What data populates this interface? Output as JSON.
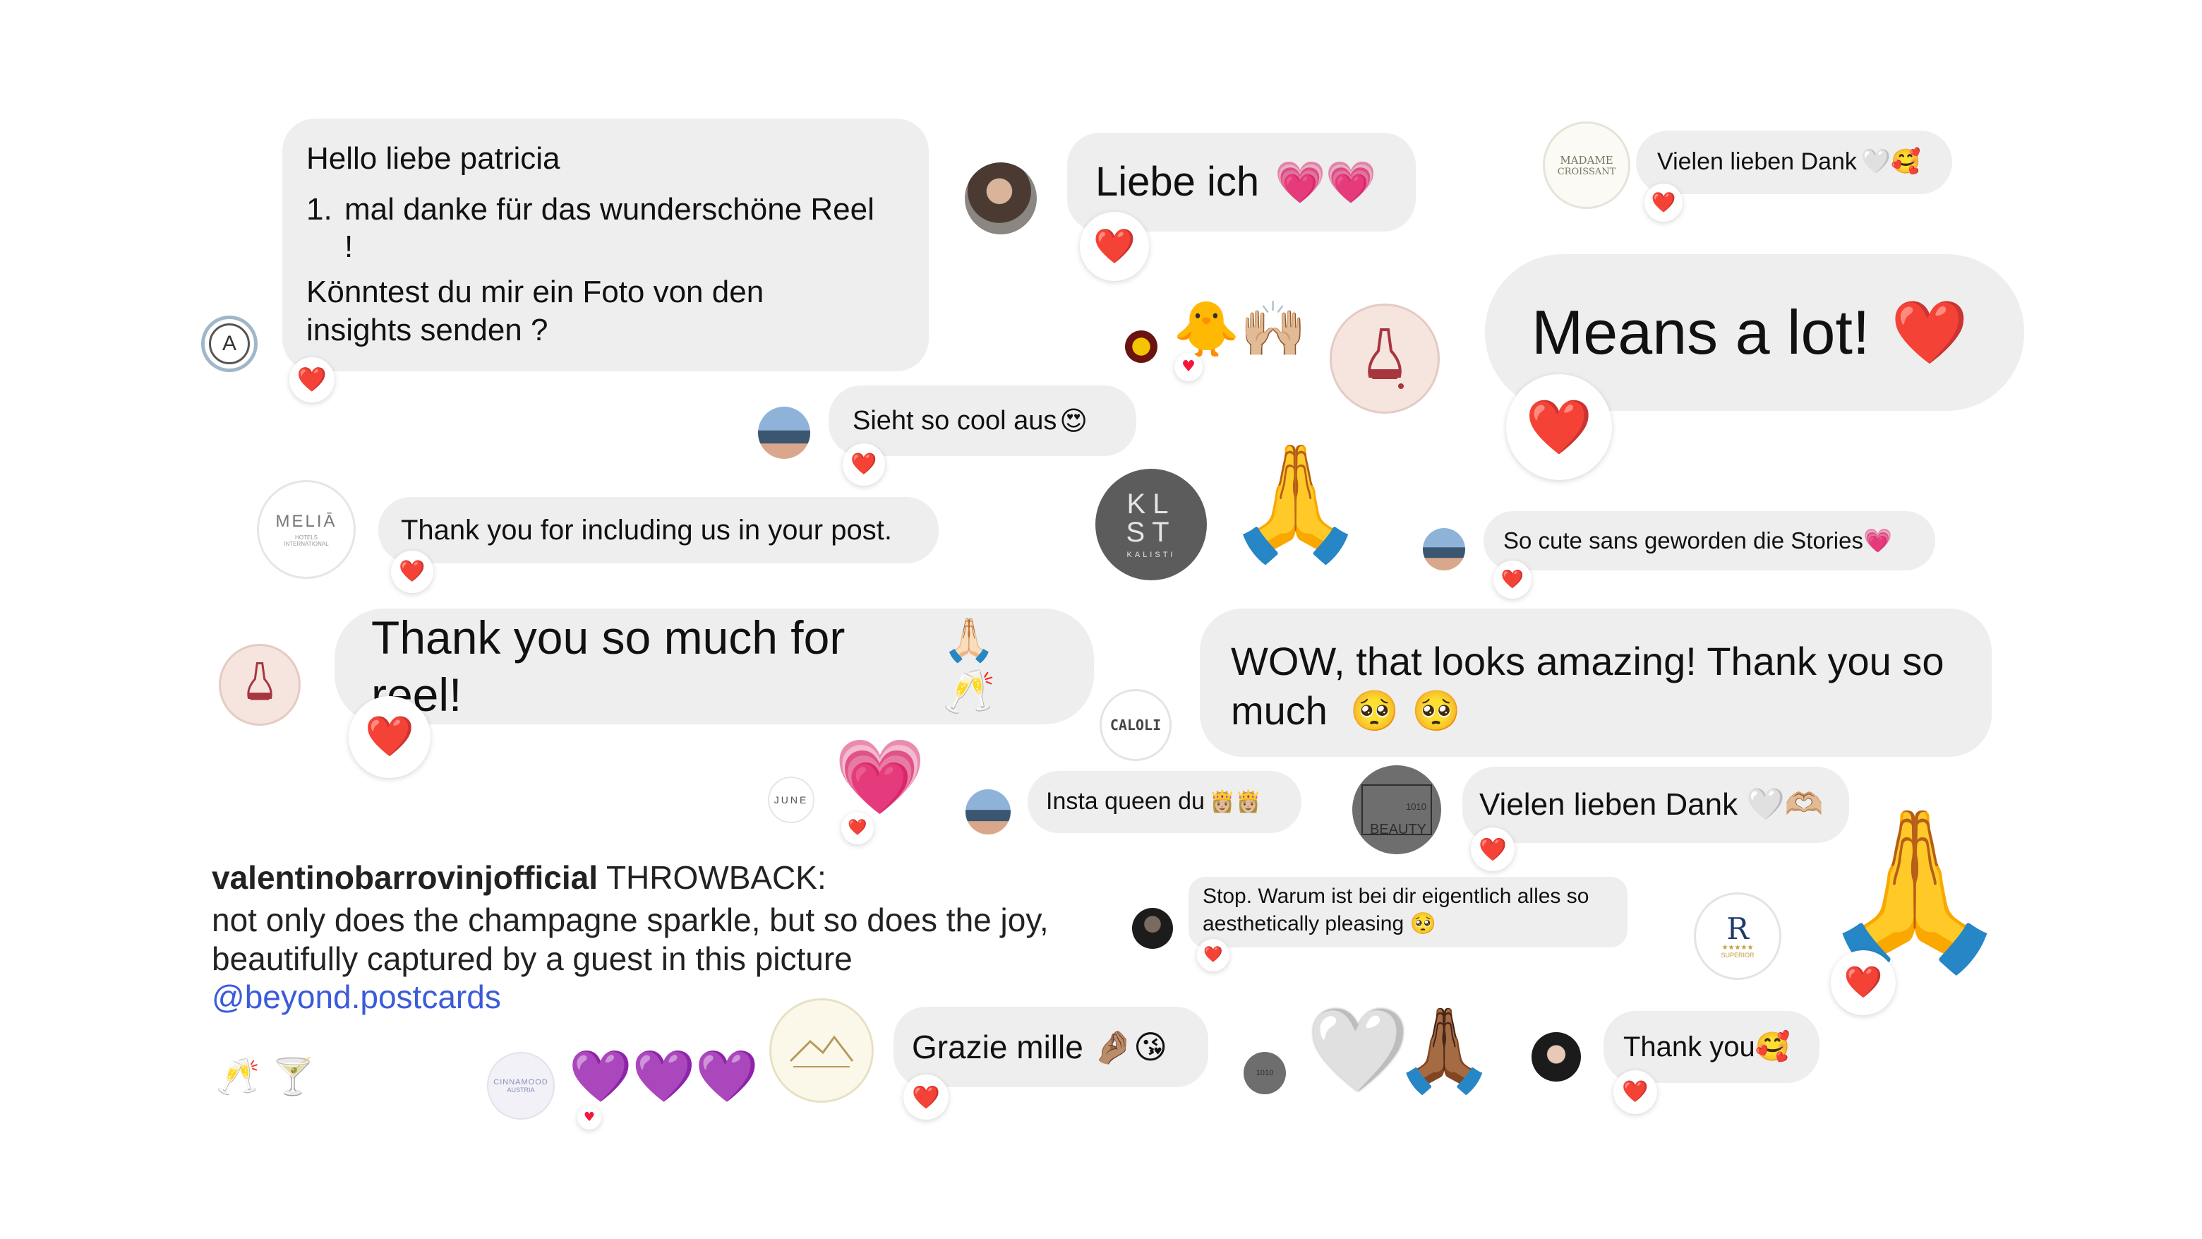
{
  "colors": {
    "bubble": "#eeeeef",
    "reaction_heart": "#f4163a",
    "link": "#3b5bdb",
    "purple_heart": "#9c3ee0",
    "pink_heart": "#e5239b",
    "pray_hands": "#f7c43a"
  },
  "icons": {
    "reaction": "red-heart",
    "pray": "folded-hands",
    "pleading": "pleading-face",
    "white_heart": "white-heart",
    "heart_hands": "heart-hands",
    "champagne": "clinking-glasses",
    "cocktail": "cocktail-glass",
    "crown_face": "princess",
    "heart_eyes": "smiling-face-with-heart-eyes",
    "smile_hearts": "smiling-face-with-hearts",
    "kiss": "face-blowing-a-kiss",
    "pinch": "pinched-fingers"
  },
  "messages": {
    "patricia": {
      "line1": "Hello liebe patricia",
      "item_number": "1.",
      "item_text": "mal danke für das wunderschöne Reel",
      "item_cont": "!",
      "line3": "Könntest du mir ein Foto von den",
      "line4": "insights senden ?"
    },
    "liebe_ich": {
      "text": "Liebe ich",
      "emoji": "💗💗"
    },
    "vielen_dank_top": {
      "text": "Vielen lieben Dank",
      "emoji": "🤍🥰"
    },
    "means_a_lot": {
      "text": "Means a lot!",
      "emoji": "❤️"
    },
    "sieht_so_cool": {
      "text": "Sieht so cool aus",
      "emoji": "😍"
    },
    "thank_including": {
      "text": "Thank you for including us in your post."
    },
    "so_cute": {
      "text": "So cute sans geworden die Stories",
      "emoji": "💗"
    },
    "thank_reel": {
      "text": "Thank you so much for reel!",
      "emoji": "🙏🏻 🥂"
    },
    "wow": {
      "line1": "WOW, that looks amazing! Thank you so",
      "line2": "much",
      "emoji": "🥺 🥺"
    },
    "insta_queen": {
      "text": "Insta queen du",
      "emoji": "👸🏼👸🏼"
    },
    "vielen_dank_mid": {
      "text": "Vielen lieben Dank",
      "emoji": "🤍🫶🏼"
    },
    "stop": {
      "line1": "Stop. Warum ist bei dir eigentlich alles so",
      "line2": "aesthetically pleasing",
      "emoji": "🥺"
    },
    "grazie": {
      "text": "Grazie mille",
      "emoji": "🤌🏽😘"
    },
    "thank_you": {
      "text": "Thank you",
      "emoji": "🥰"
    }
  },
  "caption": {
    "username": "valentinobarrovinjofficial",
    "lead": "THROWBACK:",
    "line2": "not only does the champagne sparkle, but so does the joy,",
    "line3": "beautifully captured by a guest in this picture",
    "mention": "@beyond.postcards",
    "emoji": "🥂 🍸"
  },
  "reactions": {
    "heart": "❤️",
    "heart_small": "♥"
  },
  "standalone": {
    "pray_big": "🙏",
    "pray_right": "🙏",
    "pray_dark": "🙏🏾",
    "white_heart": "🤍",
    "pink_beating": "💗",
    "purple_hearts": "💜💜💜",
    "duck_hands": "🐥🙌🏼"
  },
  "avatars": {
    "a_logo": "A",
    "madame": {
      "line1": "MADAME",
      "line2": "CROISSANT"
    },
    "melia": {
      "name": "MELIĀ",
      "sub": "HOTELS INTERNATIONAL"
    },
    "klst": {
      "line1": "KL",
      "line2": "ST",
      "sub": "KALISTI"
    },
    "caloli": "CALOLI",
    "june": "JUNE",
    "beauty": {
      "num": "1010",
      "word": "BEAUTY"
    },
    "r_superior": {
      "letter": "R",
      "stars": "★★★★★",
      "sub": "SUPERIOR"
    },
    "cinnamood": {
      "line1": "CINNAMOOD",
      "line2": "AUSTRIA"
    },
    "beauty_small": "1010"
  }
}
